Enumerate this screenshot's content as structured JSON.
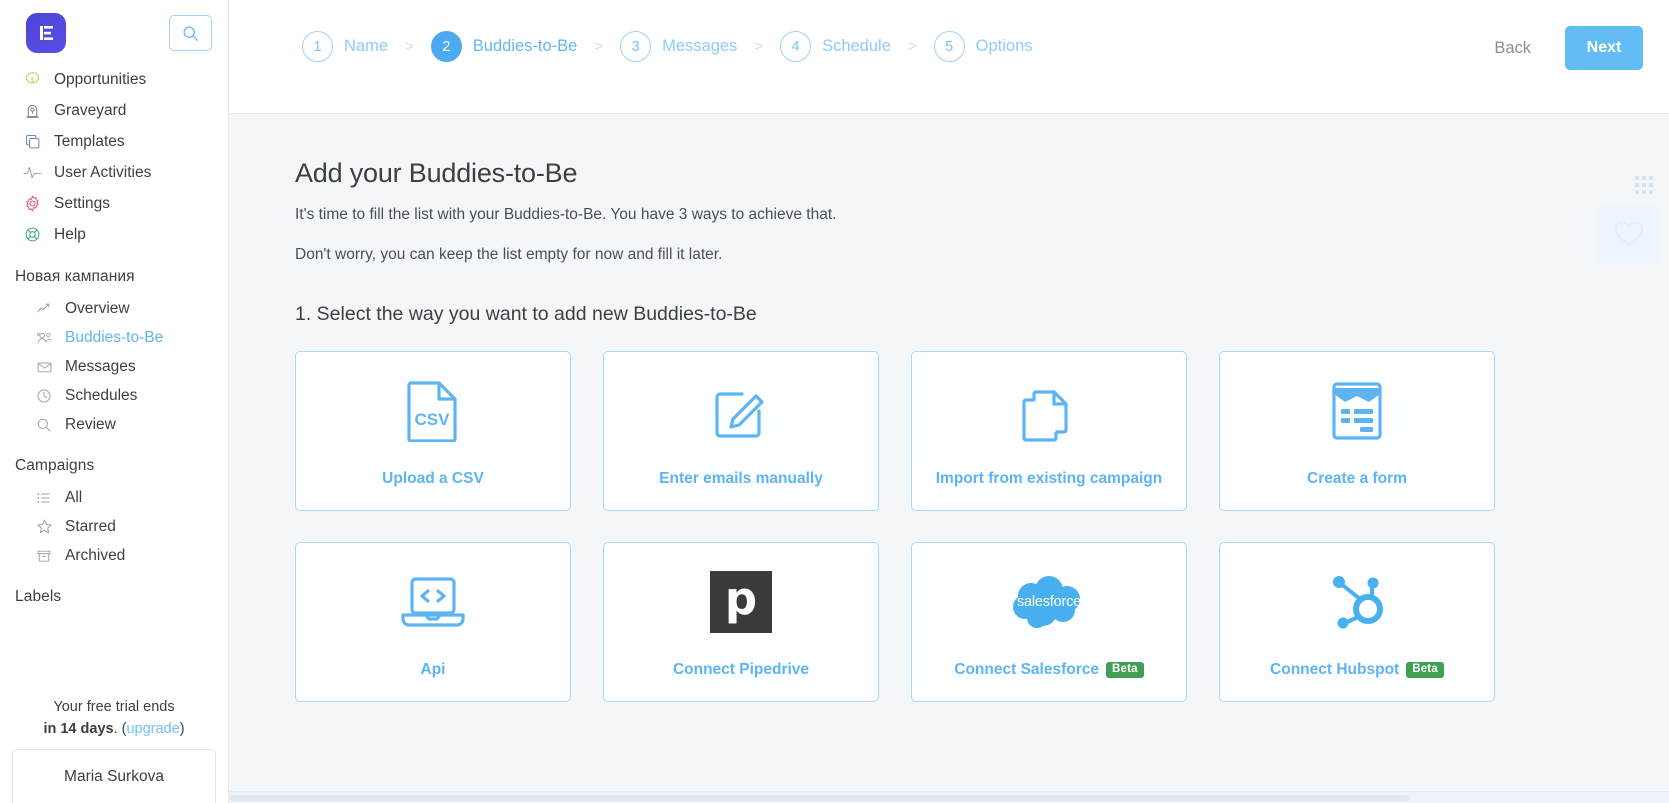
{
  "sidebar": {
    "logo_name": "app-logo",
    "search_placeholder": "Search",
    "nav": [
      {
        "label": "Opportunities",
        "icon": "dollar-badge-icon"
      },
      {
        "label": "Graveyard",
        "icon": "tombstone-icon"
      },
      {
        "label": "Templates",
        "icon": "copy-icon"
      },
      {
        "label": "User Activities",
        "icon": "pulse-icon"
      },
      {
        "label": "Settings",
        "icon": "gear-icon"
      },
      {
        "label": "Help",
        "icon": "lifebuoy-icon"
      }
    ],
    "campaign_section": {
      "title": "Новая кампания",
      "items": [
        {
          "label": "Overview",
          "icon": "chart-line-icon",
          "active": false
        },
        {
          "label": "Buddies-to-Be",
          "icon": "people-icon",
          "active": true
        },
        {
          "label": "Messages",
          "icon": "envelope-icon",
          "active": false
        },
        {
          "label": "Schedules",
          "icon": "clock-icon",
          "active": false
        },
        {
          "label": "Review",
          "icon": "search-icon",
          "active": false
        }
      ]
    },
    "campaigns_section": {
      "title": "Campaigns",
      "items": [
        {
          "label": "All",
          "icon": "list-icon"
        },
        {
          "label": "Starred",
          "icon": "star-icon"
        },
        {
          "label": "Archived",
          "icon": "archive-box-icon"
        }
      ]
    },
    "labels_section": {
      "title": "Labels"
    },
    "trial": {
      "line1": "Your free trial ends",
      "bold": "in 14 days",
      "period": ".",
      "paren_open": "(",
      "upgrade": "upgrade",
      "paren_close": ")"
    },
    "user_name": "Maria Surkova"
  },
  "topbar": {
    "steps": [
      {
        "num": "1",
        "label": "Name",
        "current": false
      },
      {
        "num": "2",
        "label": "Buddies-to-Be",
        "current": true
      },
      {
        "num": "3",
        "label": "Messages",
        "current": false
      },
      {
        "num": "4",
        "label": "Schedule",
        "current": false
      },
      {
        "num": "5",
        "label": "Options",
        "current": false
      }
    ],
    "separator": ">",
    "back_label": "Back",
    "next_label": "Next"
  },
  "main": {
    "title": "Add your Buddies-to-Be",
    "subtitle_1": "It's time to fill the list with your Buddies-to-Be. You have 3 ways to achieve that.",
    "subtitle_2": "Don't worry, you can keep the list empty for now and fill it later.",
    "section_heading": "1. Select the way you want to add new Buddies-to-Be",
    "cards": [
      {
        "label": "Upload a CSV",
        "icon": "csv-file-icon",
        "badge": null
      },
      {
        "label": "Enter emails manually",
        "icon": "pencil-square-icon",
        "badge": null
      },
      {
        "label": "Import from existing campaign",
        "icon": "documents-copy-icon",
        "badge": null
      },
      {
        "label": "Create a form",
        "icon": "form-clipboard-icon",
        "badge": null
      },
      {
        "label": "Api",
        "icon": "laptop-code-icon",
        "badge": null
      },
      {
        "label": "Connect Pipedrive",
        "icon": "pipedrive-logo-icon",
        "badge": null,
        "logo_letter": "p"
      },
      {
        "label": "Connect Salesforce",
        "icon": "salesforce-cloud-icon",
        "badge": "Beta",
        "logo_text": "salesforce"
      },
      {
        "label": "Connect Hubspot",
        "icon": "hubspot-sprocket-icon",
        "badge": "Beta"
      }
    ]
  },
  "colors": {
    "accent_blue": "#5eb4f2",
    "next_button": "#64bcf5",
    "card_border": "#a9d9f6",
    "beta_green": "#3f9f53",
    "logo_purple": "#4c44d8",
    "content_bg": "#f4f7fa",
    "text_dark": "#3c4043"
  }
}
